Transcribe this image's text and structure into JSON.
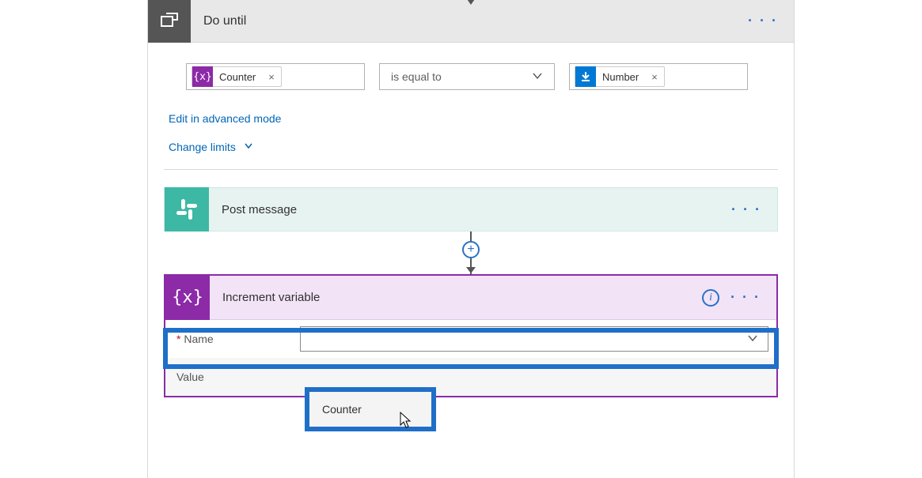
{
  "do_until": {
    "title": "Do until",
    "token_left": {
      "label": "Counter"
    },
    "operator": "is equal to",
    "token_right": {
      "label": "Number"
    },
    "link_advanced": "Edit in advanced mode",
    "link_limits": "Change limits"
  },
  "post": {
    "title": "Post message"
  },
  "increment": {
    "title": "Increment variable",
    "field_name_label": "Name",
    "field_value_label": "Value",
    "dropdown_option": "Counter"
  },
  "colors": {
    "purple": "#8c2aa8",
    "blue": "#0078d4",
    "teal": "#3db8a4",
    "highlight": "#1f6fc9",
    "link": "#0066b8"
  }
}
